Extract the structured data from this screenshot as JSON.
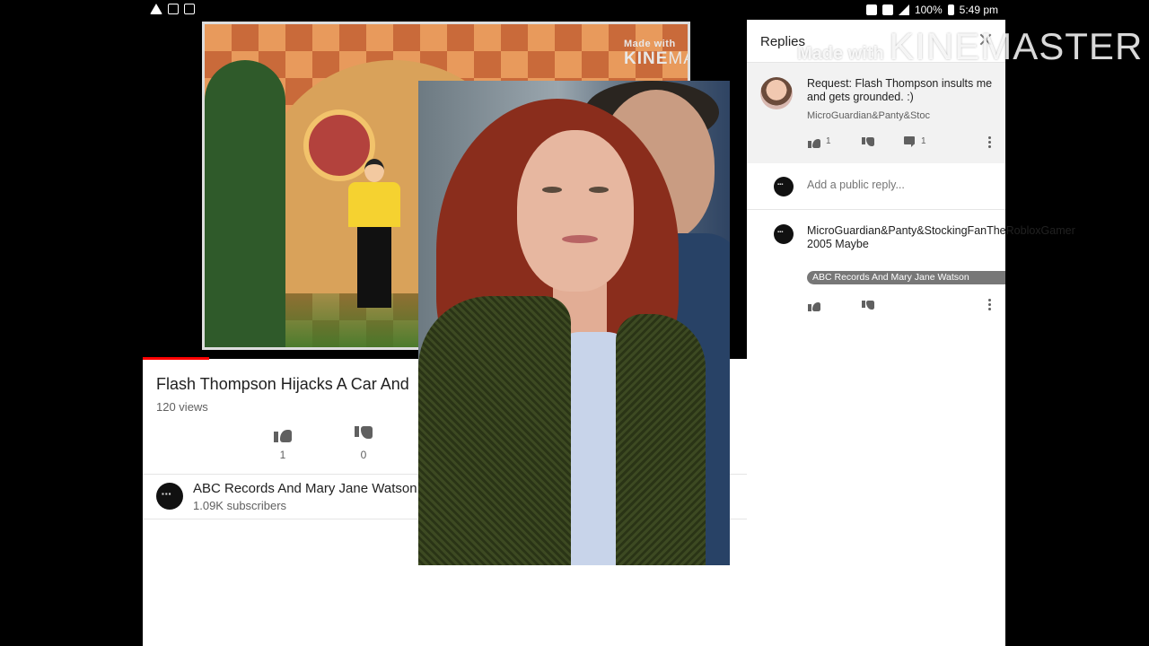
{
  "status_bar": {
    "battery": "100%",
    "time": "5:49 pm"
  },
  "watermark": {
    "made_with": "Made with",
    "brand_bold": "KINE",
    "brand_rest": "MASTER"
  },
  "video": {
    "title": "Flash Thompson Hijacks A Car And",
    "views": "120 views",
    "likes": "1",
    "dislikes": "0"
  },
  "channel": {
    "name": "ABC Records And Mary Jane Watson",
    "subscribers": "1.09K subscribers"
  },
  "replies_panel": {
    "title": "Replies",
    "parent_comment": {
      "text": "Request: Flash Thompson insults me and gets grounded. :)",
      "author": "MicroGuardian&Panty&Stoc",
      "likes": "1",
      "replies": "1"
    },
    "add_reply_placeholder": "Add a public reply...",
    "reply": {
      "text": "MicroGuardian&Panty&StockingFanTheRobloxGamer 2005 Maybe",
      "author_tag": "ABC Records And Mary Jane Watson"
    }
  }
}
